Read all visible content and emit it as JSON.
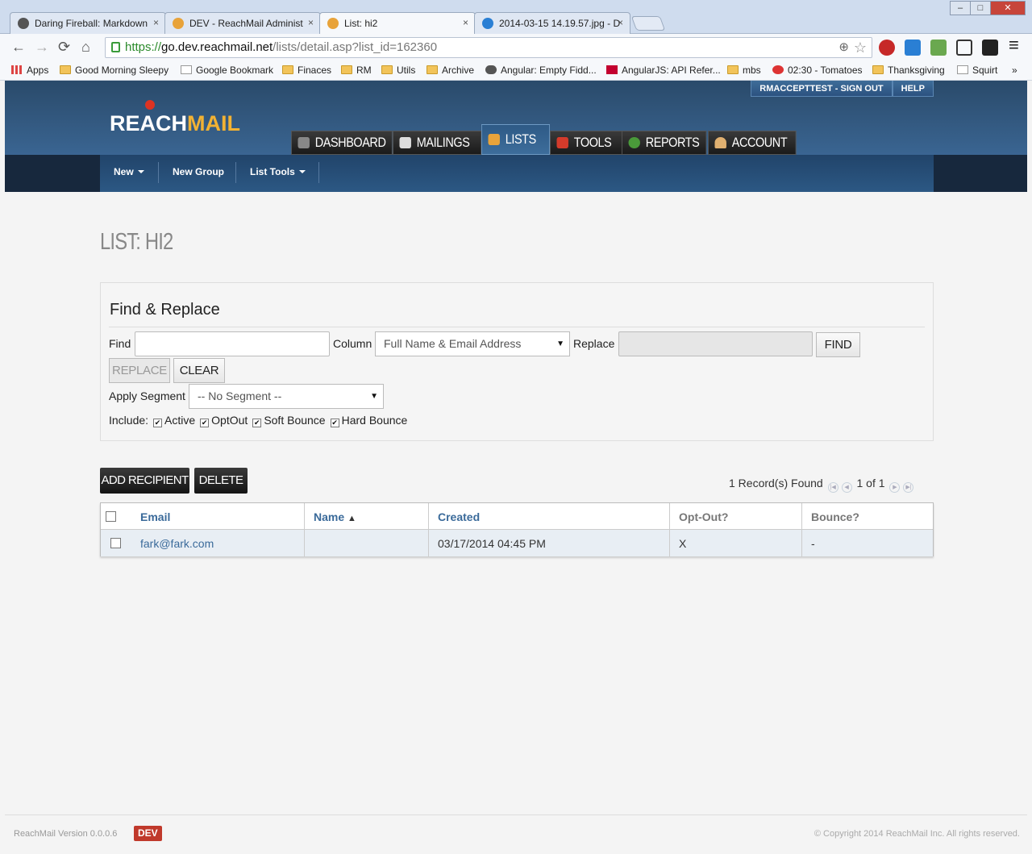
{
  "browser": {
    "tabs": [
      {
        "title": "Daring Fireball: Markdown",
        "close": "×"
      },
      {
        "title": "DEV - ReachMail Administ",
        "close": "×"
      },
      {
        "title": "List: hi2",
        "close": "×"
      },
      {
        "title": "2014-03-15 14.19.57.jpg - D",
        "close": "×"
      }
    ],
    "window_buttons": {
      "minimize": "‒",
      "maximize": "□",
      "close": "✕"
    },
    "nav": {
      "back": "←",
      "forward": "→",
      "reload": "⟳",
      "home": "⌂"
    },
    "url": {
      "scheme": "https://",
      "host": "go.dev.reachmail.net",
      "path": "/lists/detail.asp?list_id=162360"
    },
    "icons": {
      "zoom": "search-icon",
      "star": "star-icon"
    },
    "zoom_glyph": "⊕",
    "star_glyph": "☆",
    "menu_glyph": "≡",
    "bookmarks": [
      {
        "label": "Apps",
        "icon": "apps-icon"
      },
      {
        "label": "Good Morning Sleepy",
        "icon": "folder-icon"
      },
      {
        "label": "Google Bookmark",
        "icon": "page-icon"
      },
      {
        "label": "Finaces",
        "icon": "folder-icon"
      },
      {
        "label": "RM",
        "icon": "folder-icon"
      },
      {
        "label": "Utils",
        "icon": "folder-icon"
      },
      {
        "label": "Archive",
        "icon": "folder-icon"
      },
      {
        "label": "Angular: Empty Fidd...",
        "icon": "cloud-icon"
      },
      {
        "label": "AngularJS: API Refer...",
        "icon": "angular-icon"
      },
      {
        "label": "mbs",
        "icon": "folder-icon"
      },
      {
        "label": "02:30 - Tomatoes",
        "icon": "tomato-icon"
      },
      {
        "label": "Thanksgiving",
        "icon": "folder-icon"
      },
      {
        "label": "Squirt",
        "icon": "page-icon"
      }
    ],
    "more_bookmarks": "»"
  },
  "app": {
    "logo": {
      "reach": "REACH",
      "mail": "MAIL"
    },
    "top_links": {
      "signout": "RMACCEPTTEST - SIGN OUT",
      "help": "HELP"
    },
    "main_nav": [
      {
        "label": "DASHBOARD",
        "icon": "dashboard-icon",
        "color": "#888888"
      },
      {
        "label": "MAILINGS",
        "icon": "envelope-icon",
        "color": "#dddddd"
      },
      {
        "label": "LISTS",
        "icon": "notebook-icon",
        "color": "#e8a33a"
      },
      {
        "label": "TOOLS",
        "icon": "toolbox-icon",
        "color": "#d43b2b"
      },
      {
        "label": "REPORTS",
        "icon": "pie-chart-icon",
        "color": "#4a9a3a"
      },
      {
        "label": "ACCOUNT",
        "icon": "user-icon",
        "color": "#e0b070"
      }
    ],
    "sub_nav": {
      "new": "New",
      "new_group": "New Group",
      "list_tools": "List Tools"
    }
  },
  "page": {
    "title": "LIST: HI2",
    "find_replace": {
      "heading": "Find & Replace",
      "find_label": "Find",
      "find_value": "",
      "column_label": "Column",
      "column_value": "Full Name & Email Address",
      "replace_label": "Replace",
      "replace_value": "",
      "find_button": "FIND",
      "replace_button": "REPLACE",
      "clear_button": "CLEAR",
      "segment_label": "Apply Segment",
      "segment_value": "-- No Segment --",
      "include_label": "Include:",
      "include": [
        {
          "label": "Active",
          "checked": true
        },
        {
          "label": "OptOut",
          "checked": true
        },
        {
          "label": "Soft Bounce",
          "checked": true
        },
        {
          "label": "Hard Bounce",
          "checked": true
        }
      ]
    },
    "actions": {
      "add": "ADD RECIPIENT",
      "delete": "DELETE"
    },
    "records": {
      "found": "1 Record(s) Found",
      "page": "1 of 1"
    },
    "table": {
      "columns": [
        "Email",
        "Name",
        "Created",
        "Opt-Out?",
        "Bounce?"
      ],
      "sort_indicator": "▲",
      "rows": [
        {
          "email": "fark@fark.com",
          "name": "",
          "created": "03/17/2014 04:45 PM",
          "optout": "X",
          "bounce": "-"
        }
      ]
    }
  },
  "footer": {
    "version": "ReachMail Version 0.0.0.6",
    "env": "DEV",
    "copyright": "© Copyright 2014 ReachMail Inc. All rights reserved."
  }
}
